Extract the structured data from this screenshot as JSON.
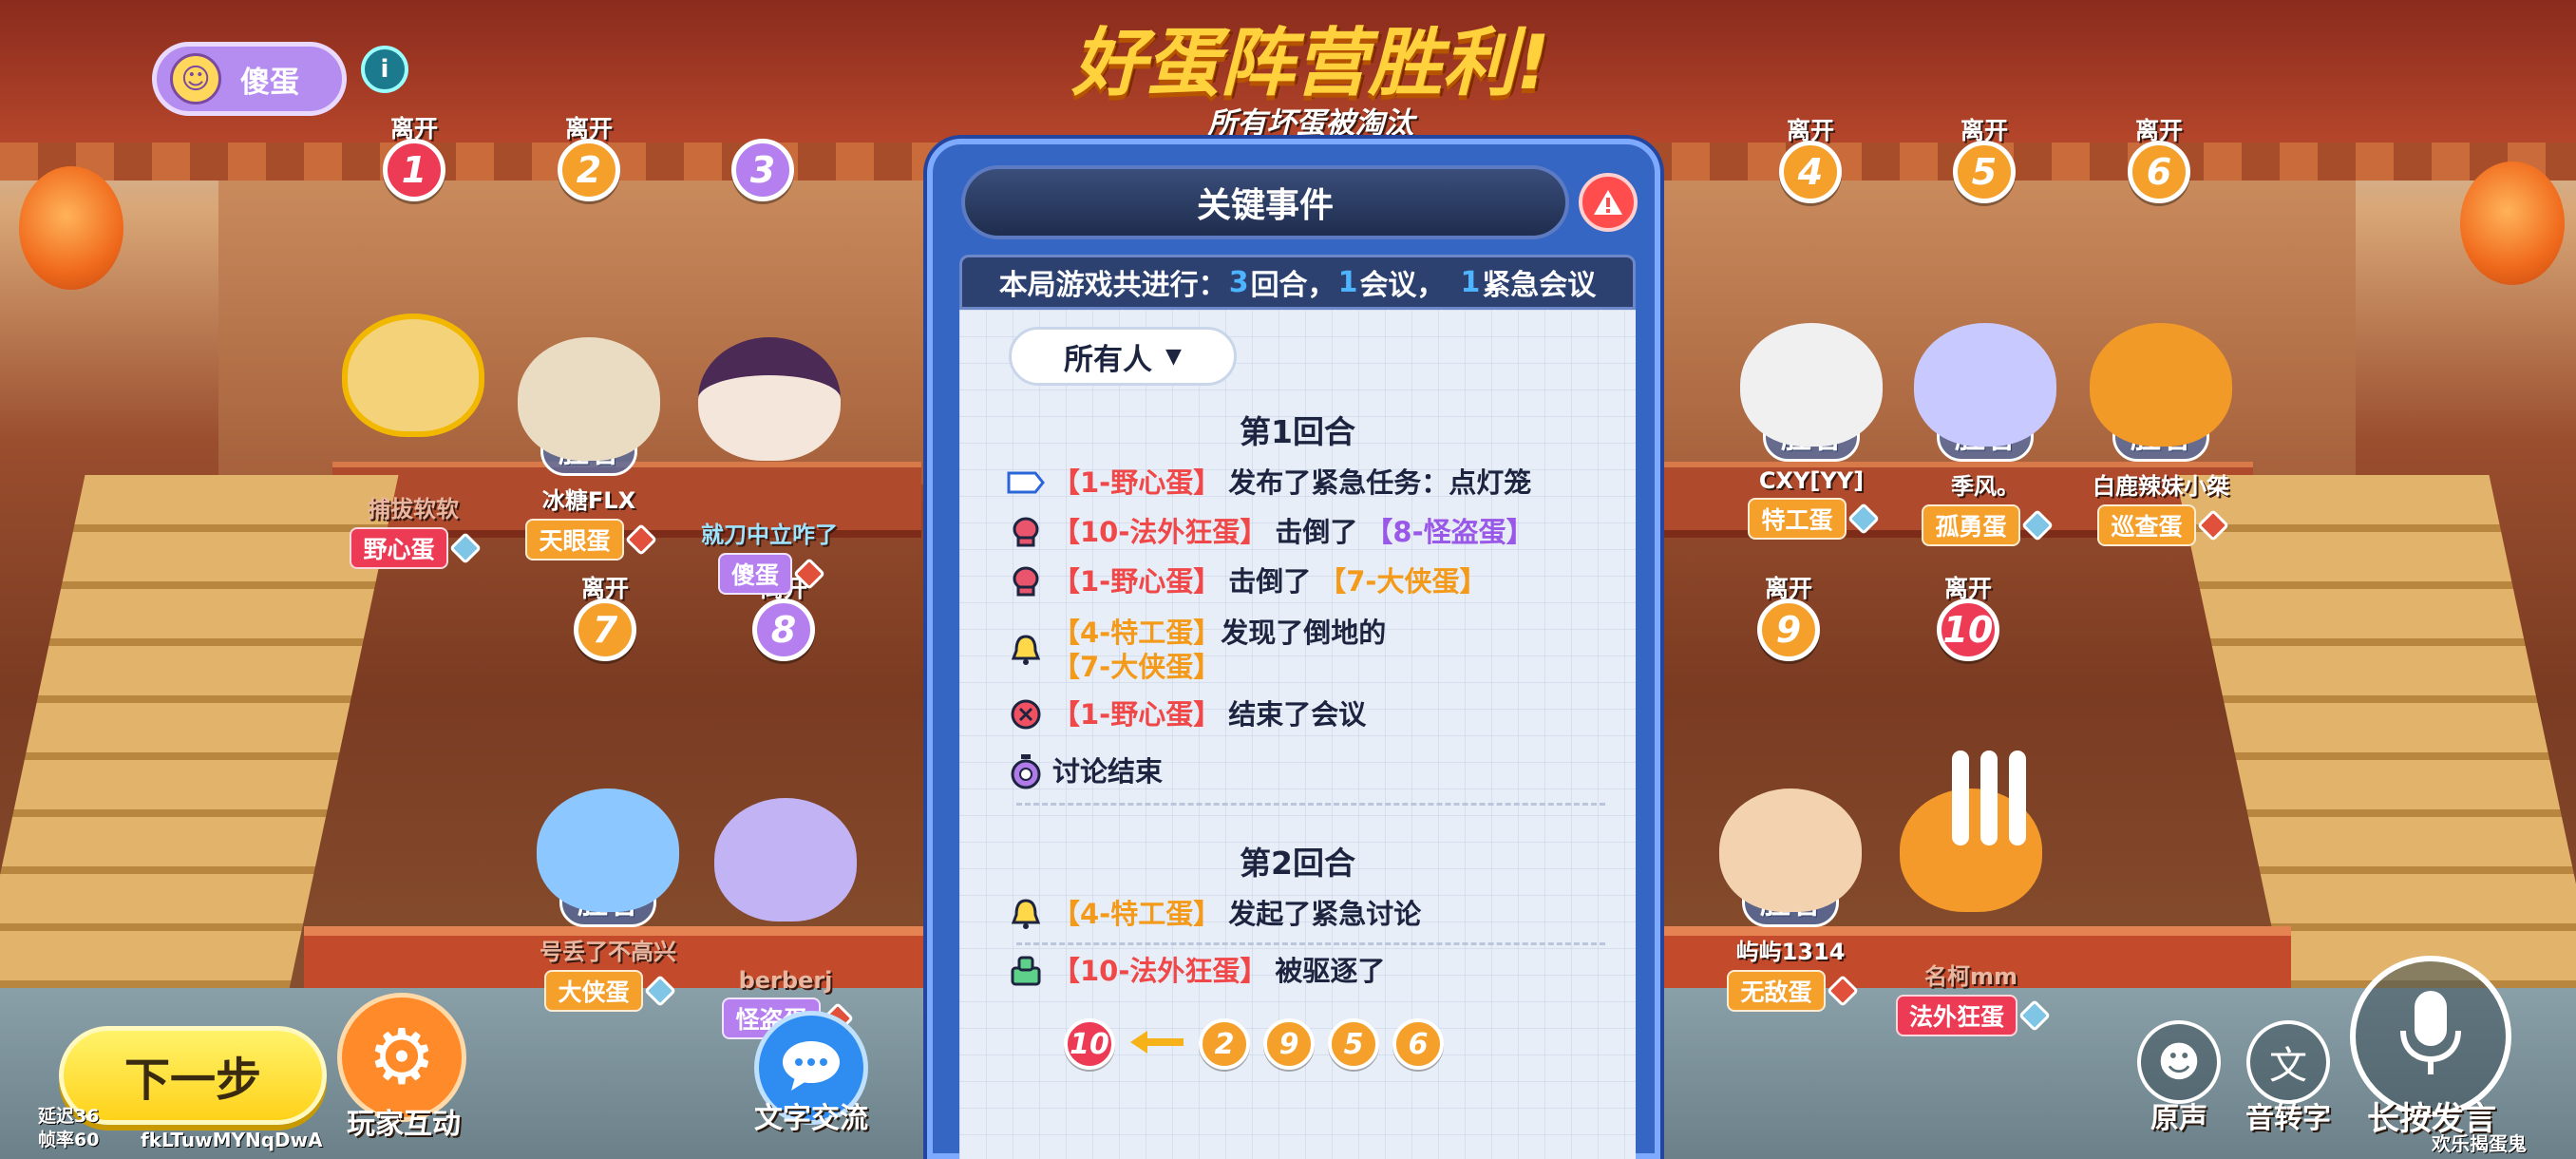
{
  "header": {
    "my_role": "傻蛋",
    "info_icon": "info-icon",
    "title": "好蛋阵营胜利!",
    "subtitle": "所有坏蛋被淘汰"
  },
  "seats": [
    {
      "num": "1",
      "status": "离开",
      "color": "#ee3b55"
    },
    {
      "num": "2",
      "status": "离开",
      "color": "#f5a02a"
    },
    {
      "num": "3",
      "status": "",
      "color": "#b67ff0"
    },
    {
      "num": "4",
      "status": "离开",
      "color": "#f5a02a"
    },
    {
      "num": "5",
      "status": "离开",
      "color": "#f5a02a"
    },
    {
      "num": "6",
      "status": "离开",
      "color": "#f5a02a"
    },
    {
      "num": "7",
      "status": "离开",
      "color": "#f5a02a"
    },
    {
      "num": "8",
      "status": "离开",
      "color": "#b67ff0"
    },
    {
      "num": "9",
      "status": "离开",
      "color": "#f5a02a"
    },
    {
      "num": "10",
      "status": "离开",
      "color": "#ee3b55"
    }
  ],
  "players": [
    {
      "name": "捕拔软软",
      "role": "野心蛋",
      "role_color": "#ee3b55",
      "winner": "",
      "body_color": "#f3d27a"
    },
    {
      "name": "冰糖FLX",
      "role": "天眼蛋",
      "role_color": "#f5a02a",
      "winner": "胜者",
      "body_color": "#e9dcc2"
    },
    {
      "name": "就刀中立咋了",
      "role": "傻蛋",
      "role_color": "#b67ff0",
      "winner": "",
      "body_color": "#f5e6dc"
    },
    {
      "name": "CXY[YY]",
      "role": "特工蛋",
      "role_color": "#f5a02a",
      "winner": "胜者",
      "body_color": "#f0f0f0"
    },
    {
      "name": "季风。",
      "role": "孤勇蛋",
      "role_color": "#f5a02a",
      "winner": "胜者",
      "body_color": "#c7c9ff"
    },
    {
      "name": "白鹿辣妹小桀",
      "role": "巡查蛋",
      "role_color": "#f5a02a",
      "winner": "胜者",
      "body_color": "#f29a28"
    },
    {
      "name": "号丢了不高兴",
      "role": "大侠蛋",
      "role_color": "#f5a02a",
      "winner": "胜者",
      "body_color": "#8cc8ff"
    },
    {
      "name": "berberj",
      "role": "怪盗蛋",
      "role_color": "#b67ff0",
      "winner": "",
      "body_color": "#c2b3f5"
    },
    {
      "name": "屿屿1314",
      "role": "无敌蛋",
      "role_color": "#f5a02a",
      "winner": "胜者",
      "body_color": "#f3d2b0"
    },
    {
      "name": "名柯mm",
      "role": "法外狂蛋",
      "role_color": "#ee3b55",
      "winner": "",
      "body_color": "#f39a2a"
    }
  ],
  "panel": {
    "title": "关键事件",
    "alert_icon": "warning-icon",
    "summary": {
      "prefix": "本局游戏共进行：",
      "rounds": "3",
      "rounds_label": "回合，",
      "meetings": "1",
      "meetings_label": "会议，",
      "urgent": "1",
      "urgent_label": "紧急会议"
    },
    "filter": "所有人",
    "round1": {
      "heading": "第1回合",
      "events": [
        {
          "icon": "tag-icon",
          "a": "【1-野心蛋】",
          "a_color": "red",
          "text": "发布了紧急任务：点灯笼",
          "b": "",
          "b_color": ""
        },
        {
          "icon": "boxing-glove-icon",
          "a": "【10-法外狂蛋】",
          "a_color": "red",
          "text": "击倒了",
          "b": "【8-怪盗蛋】",
          "b_color": "purple"
        },
        {
          "icon": "boxing-glove-icon",
          "a": "【1-野心蛋】",
          "a_color": "red",
          "text": "击倒了",
          "b": "【7-大侠蛋】",
          "b_color": "orange"
        },
        {
          "icon": "bell-icon",
          "a": "【4-特工蛋】",
          "a_color": "orange",
          "text": "发现了倒地的",
          "b": "【7-大侠蛋】",
          "b_color": "orange"
        },
        {
          "icon": "close-circle-icon",
          "a": "【1-野心蛋】",
          "a_color": "red",
          "text": "结束了会议",
          "b": "",
          "b_color": ""
        },
        {
          "icon": "timer-icon",
          "a": "",
          "a_color": "",
          "text": "讨论结束",
          "b": "",
          "b_color": ""
        }
      ]
    },
    "round2": {
      "heading": "第2回合",
      "events": [
        {
          "icon": "bell-icon",
          "a": "【4-特工蛋】",
          "a_color": "orange",
          "text": "发起了紧急讨论",
          "b": "",
          "b_color": ""
        },
        {
          "icon": "eject-icon",
          "a": "【10-法外狂蛋】",
          "a_color": "red",
          "text": "被驱逐了",
          "b": "",
          "b_color": ""
        }
      ]
    },
    "votes": {
      "target": "10",
      "voters": [
        "2",
        "9",
        "5",
        "6"
      ]
    }
  },
  "controls": {
    "next": "下一步",
    "interact": "玩家互动",
    "chat": "文字交流",
    "original_voice": "原声",
    "voice_to_text": "音转字",
    "hold_to_talk": "长按发言",
    "latency": "延迟36",
    "fps": "帧率60",
    "room_id": "fkLTuwMYNqDwA",
    "watermark": "欢乐揭蛋鬼"
  }
}
